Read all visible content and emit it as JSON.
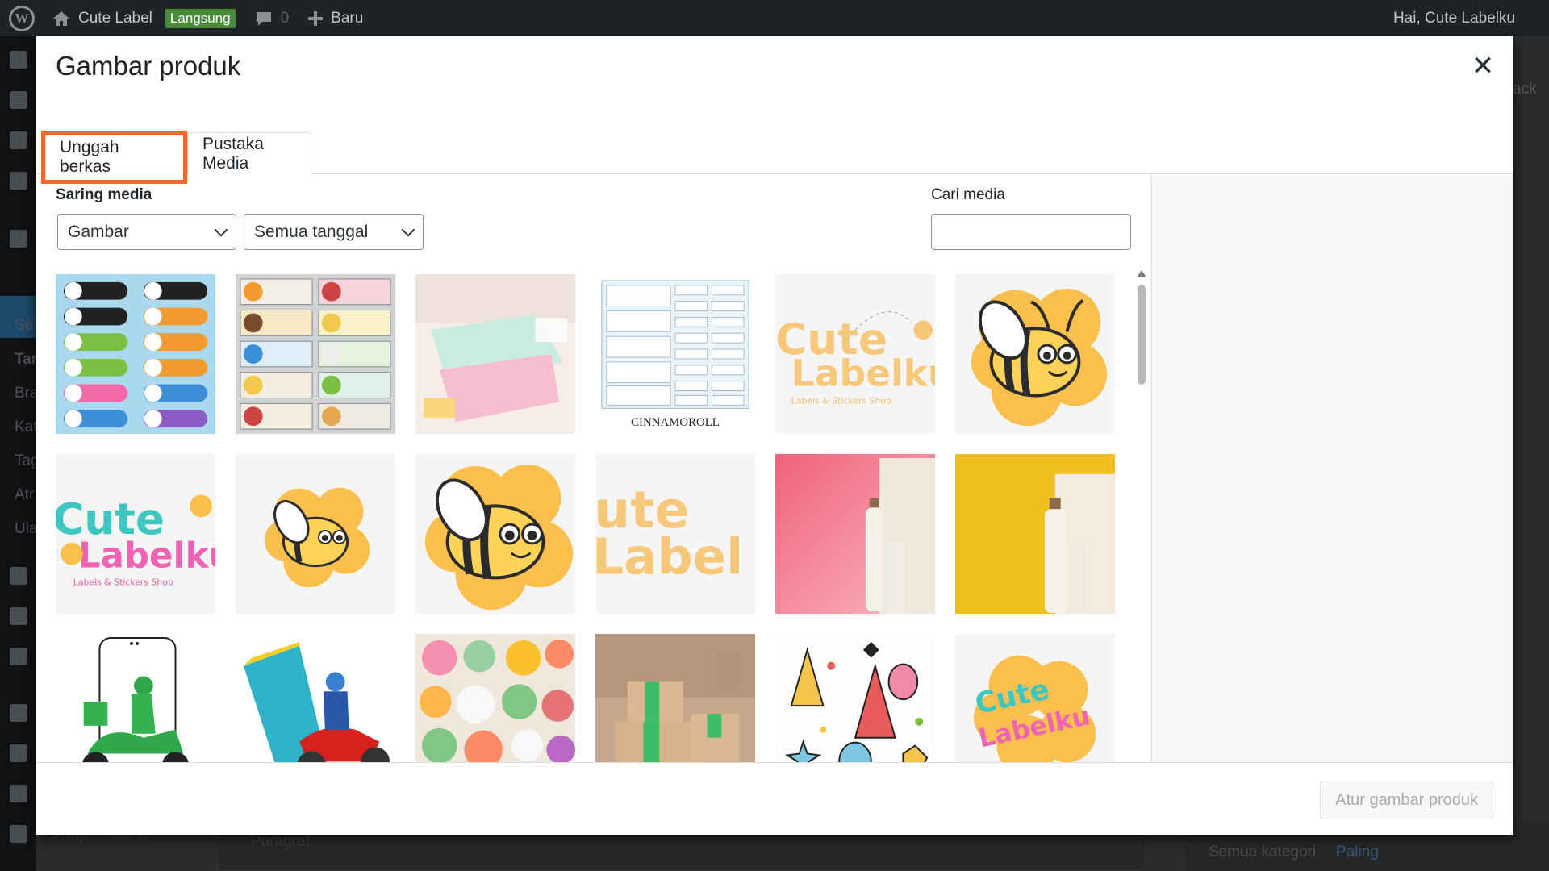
{
  "admin_bar": {
    "site_name": "Cute Label",
    "status_badge": "Langsung",
    "comments_count": "0",
    "new_label": "Baru",
    "greeting": "Hai, Cute Labelku"
  },
  "background": {
    "menu_fragments": [
      "Ser",
      "Tar",
      "Bra",
      "Kat",
      "Tag",
      "Atr",
      "Ula"
    ],
    "collapse_menu": "Collapse Menu",
    "editor_paragraph": "Paragraf",
    "category_all": "Semua kategori",
    "category_popular": "Paling",
    "right_fragment": "ack"
  },
  "modal": {
    "title": "Gambar produk",
    "close_icon": "close-icon",
    "tabs": [
      {
        "label": "Unggah berkas",
        "highlighted": true
      },
      {
        "label": "Pustaka Media",
        "active": true
      }
    ],
    "filter_label": "Saring media",
    "filter_type": {
      "selected": "Gambar"
    },
    "filter_date": {
      "selected": "Semua tanggal"
    },
    "search_label": "Cari media",
    "search_value": "",
    "selected_index": 3,
    "media": [
      {
        "name": "tsum-tsum-salsabila-labels"
      },
      {
        "name": "tsum-tsum-labels-grid"
      },
      {
        "name": "pencil-case-photo"
      },
      {
        "name": "cinnamoroll-labels",
        "caption": "CINNAMOROLL"
      },
      {
        "name": "cute-labelku-logo-wide",
        "logo_top": "Cute",
        "logo_bottom": "Labelku",
        "tagline": "Labels & Stickers Shop"
      },
      {
        "name": "bee-mascot"
      },
      {
        "name": "cute-labelku-logo-color",
        "logo_top": "Cute",
        "logo_bottom": "Labelku",
        "tagline": "Labels & Stickers Shop"
      },
      {
        "name": "bee-mascot-small"
      },
      {
        "name": "bee-mascot-large"
      },
      {
        "name": "cute-labelku-cropped",
        "logo_top": "ute",
        "logo_bottom": "Label"
      },
      {
        "name": "bottle-pink-background"
      },
      {
        "name": "bottle-yellow-background"
      },
      {
        "name": "delivery-phone-green"
      },
      {
        "name": "delivery-phone-red"
      },
      {
        "name": "stickers-collection"
      },
      {
        "name": "packaging-boxes"
      },
      {
        "name": "party-pattern"
      },
      {
        "name": "cute-labelku-flower-logo",
        "logo_top": "Cute",
        "logo_bottom": "Labelku"
      }
    ],
    "colors": {
      "accent": "#f06a25",
      "selected_border": "#d63cb5",
      "bee_yellow": "#fbbf4e"
    },
    "action_button": "Atur gambar produk"
  }
}
